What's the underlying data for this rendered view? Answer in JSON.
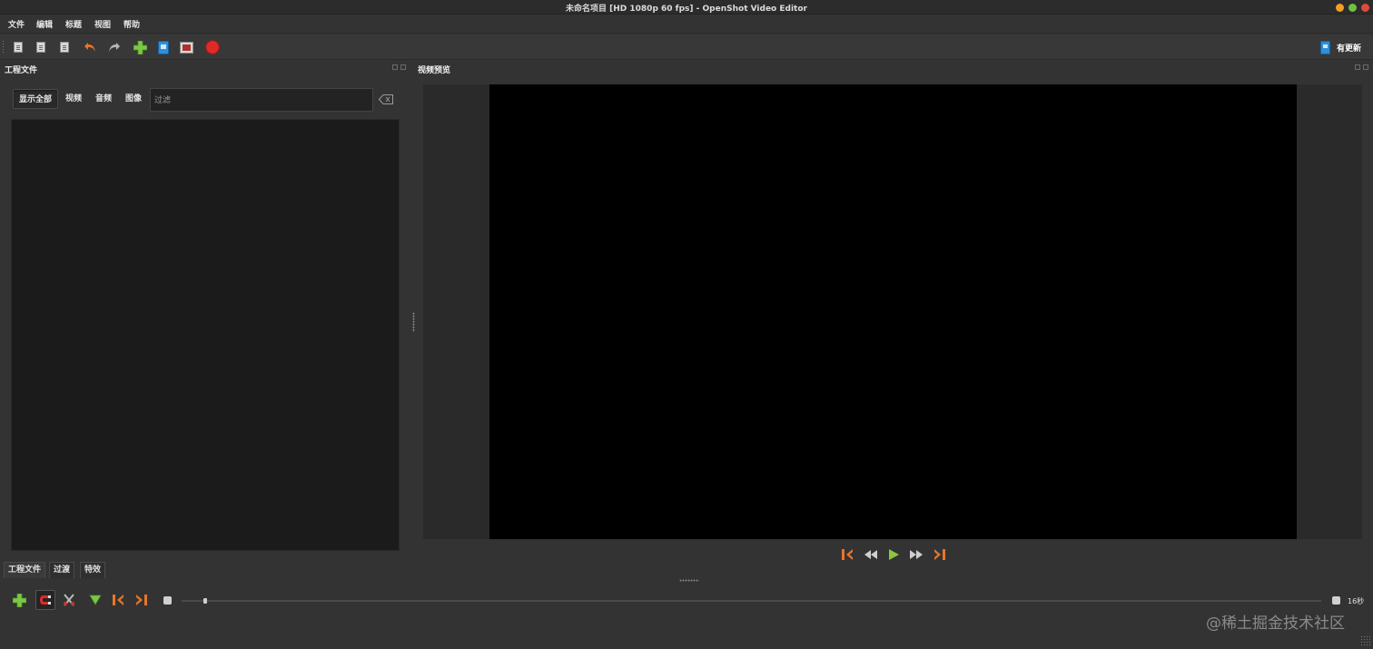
{
  "window": {
    "title": "未命名项目 [HD 1080p 60 fps] - OpenShot Video Editor"
  },
  "menu": {
    "file": "文件",
    "edit": "编辑",
    "title": "标题",
    "view": "视图",
    "help": "帮助"
  },
  "toolbar": {
    "buttons": [
      "new-project-icon",
      "open-project-icon",
      "save-project-icon",
      "undo-icon",
      "redo-icon",
      "import-files-icon",
      "profile-icon",
      "fullscreen-icon",
      "export-video-icon"
    ],
    "update_label": "有更新"
  },
  "project_files": {
    "title": "工程文件",
    "filters": {
      "show_all": "显示全部",
      "video": "视频",
      "audio": "音频",
      "image": "图像"
    },
    "filter_placeholder": "过滤"
  },
  "bottom_tabs": {
    "project_files": "工程文件",
    "transitions": "过渡",
    "effects": "特效"
  },
  "video_preview": {
    "title": "视频预览",
    "controls": [
      "jump-start-icon",
      "rewind-icon",
      "play-icon",
      "fast-forward-icon",
      "jump-end-icon"
    ]
  },
  "timeline": {
    "tools": [
      "add-track-icon",
      "snap-icon",
      "razor-icon",
      "add-marker-icon",
      "previous-marker-icon",
      "next-marker-icon"
    ],
    "zoom_label": "16秒"
  },
  "watermark": "@稀土掘金技术社区",
  "colors": {
    "window_bg": "#333333",
    "panel_bg": "#1b1b1b",
    "preview_bg": "#000000",
    "accent_orange": "#e8752a",
    "accent_green": "#7ac943",
    "record_red": "#e02a2a"
  }
}
